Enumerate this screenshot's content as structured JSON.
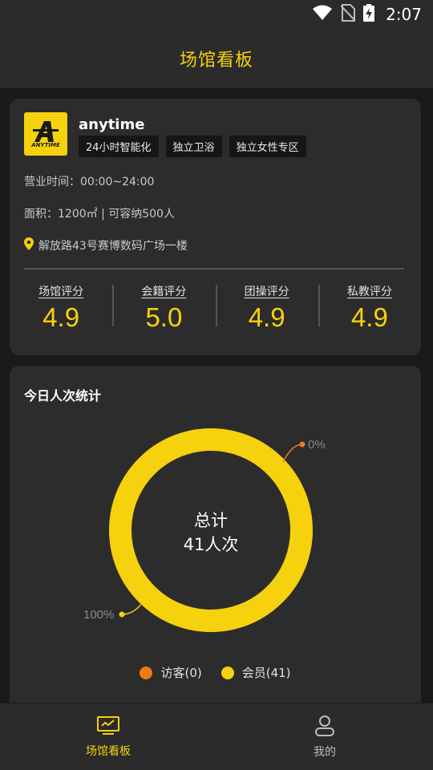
{
  "status_bar": {
    "time": "2:07"
  },
  "header": {
    "title": "场馆看板"
  },
  "gym": {
    "logo_text": "ANYTIME",
    "name": "anytime",
    "tags": [
      "24小时智能化",
      "独立卫浴",
      "独立女性专区"
    ],
    "hours": "营业时间：00:00~24:00",
    "area": "面积：1200㎡ | 可容纳500人",
    "address": "解放路43号赛博数码广场一楼",
    "ratings": [
      {
        "label": "场馆评分",
        "value": "4.9"
      },
      {
        "label": "会籍评分",
        "value": "5.0"
      },
      {
        "label": "团操评分",
        "value": "4.9"
      },
      {
        "label": "私教评分",
        "value": "4.9"
      }
    ]
  },
  "stats": {
    "title": "今日人次统计",
    "center_line1": "总计",
    "center_line2": "41人次",
    "visitor_pct": "0%",
    "member_pct": "100%",
    "legend_visitor": "访客(0)",
    "legend_member": "会员(41)"
  },
  "chart_data": {
    "type": "pie",
    "categories": [
      "访客",
      "会员"
    ],
    "values": [
      0,
      41
    ],
    "percent_labels": [
      "0%",
      "100%"
    ],
    "center_text": [
      "总计",
      "41人次"
    ],
    "colors": [
      "#f07a12",
      "#f6d10d"
    ]
  },
  "tabbar": {
    "items": [
      {
        "label": "场馆看板",
        "icon": "monitor-icon",
        "active": true
      },
      {
        "label": "我的",
        "icon": "person-icon",
        "active": false
      }
    ]
  },
  "colors": {
    "accent": "#f6d10d",
    "visitor": "#f07a12",
    "card": "#2c2c2c",
    "background": "#1a1a1a"
  }
}
